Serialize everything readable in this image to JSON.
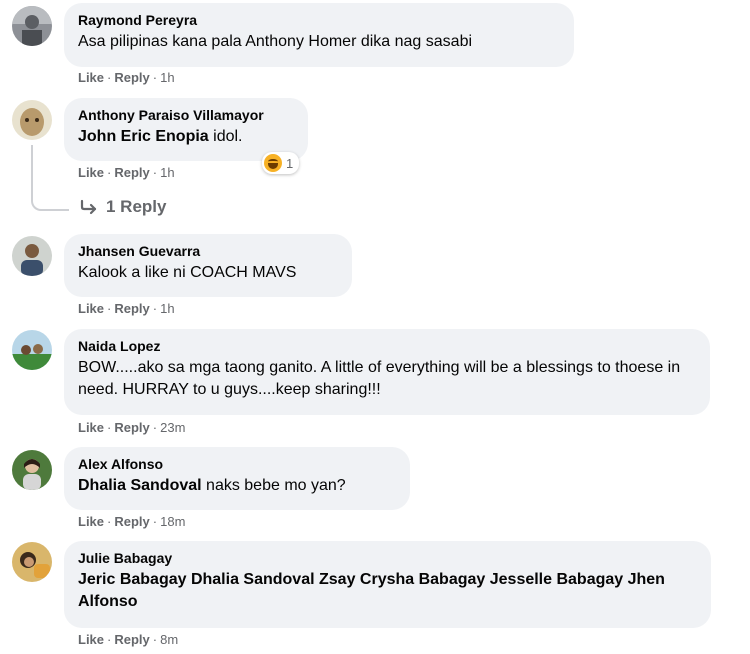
{
  "comments": [
    {
      "author": "Raymond Pereyra",
      "mention": "",
      "text": "Asa pilipinas kana pala Anthony Homer dika nag sasabi",
      "like": "Like",
      "reply": "Reply",
      "time": "1h"
    },
    {
      "author": "Anthony Paraiso Villamayor",
      "mention": "John Eric Enopia",
      "text": " idol.",
      "like": "Like",
      "reply": "Reply",
      "time": "1h",
      "reaction_count": "1",
      "reaction_icon": "haha-emoji-icon"
    },
    {
      "author": "Jhansen Guevarra",
      "mention": "",
      "text": "Kalook a like ni COACH MAVS",
      "like": "Like",
      "reply": "Reply",
      "time": "1h"
    },
    {
      "author": "Naida Lopez",
      "mention": "",
      "text": "BOW.....ako sa mga taong ganito. A little of everything will be a blessings to thoese in need. HURRAY to u guys....keep sharing!!!",
      "like": "Like",
      "reply": "Reply",
      "time": "23m"
    },
    {
      "author": "Alex Alfonso",
      "mention": "Dhalia Sandoval",
      "text": " naks bebe mo yan?",
      "like": "Like",
      "reply": "Reply",
      "time": "18m"
    },
    {
      "author": "Julie Babagay",
      "mention": "Jeric Babagay Dhalia Sandoval Zsay Crysha Babagay Jesselle Babagay Jhen Alfonso",
      "text": "",
      "like": "Like",
      "reply": "Reply",
      "time": "8m"
    }
  ],
  "replies_link": {
    "label": "1 Reply",
    "icon": "reply-arrow-icon"
  },
  "colors": {
    "bubble": "#f0f2f5",
    "meta": "#65676b",
    "text": "#050505"
  }
}
